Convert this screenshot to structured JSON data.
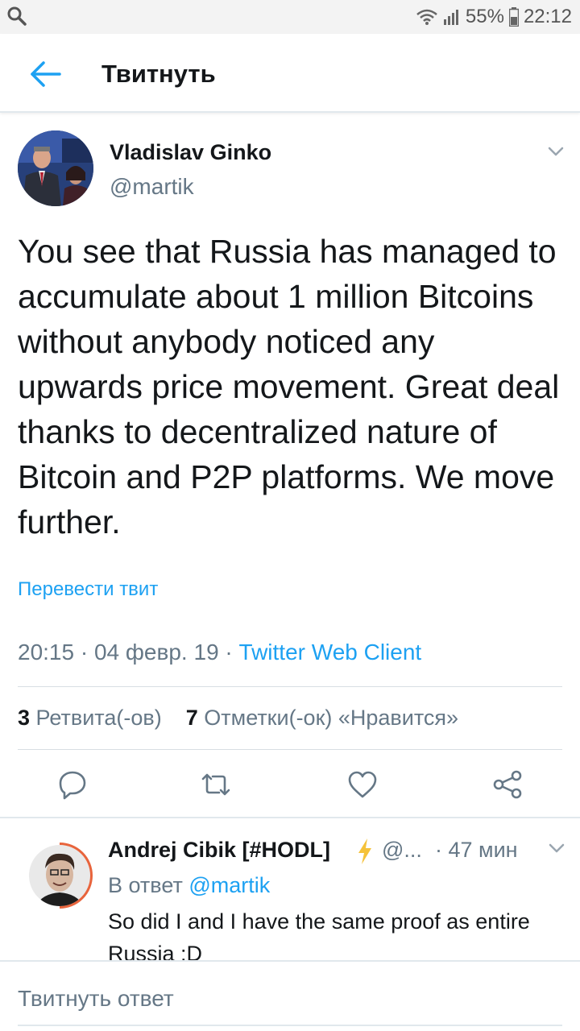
{
  "status_bar": {
    "battery": "55%",
    "time": "22:12"
  },
  "header": {
    "title": "Твитнуть"
  },
  "tweet": {
    "author_name": "Vladislav Ginko",
    "author_handle": "@martik",
    "text": "You see that Russia has managed to accumulate about 1 million Bitcoins without anybody noticed any upwards price movement. Great deal thanks to decentralized nature of Bitcoin and P2P platforms. We move further.",
    "translate_label": "Перевести твит",
    "timestamp": "20:15 · 04 февр. 19 · ",
    "client": "Twitter Web Client",
    "retweet_count": "3",
    "retweet_label": "Ретвита(-ов)",
    "like_count": "7",
    "like_label": "Отметки(-ок) «Нравится»"
  },
  "reply": {
    "author_name": "Andrej Cibik [#HODL]",
    "author_handle": "@...",
    "time": "· 47 мин",
    "reply_to_prefix": "В ответ ",
    "reply_to_mention": "@martik",
    "text": "So did I and I have the same proof as entire Russia :D"
  },
  "composer": {
    "placeholder": "Твитнуть ответ"
  },
  "colors": {
    "accent": "#1da1f2",
    "secondary_text": "#657786",
    "primary_text": "#14171a"
  }
}
